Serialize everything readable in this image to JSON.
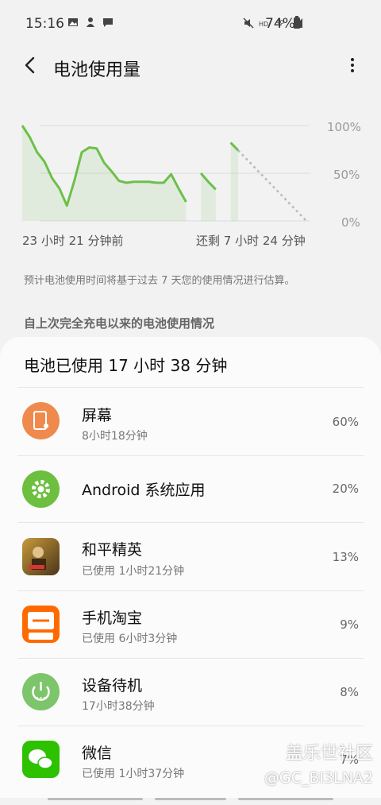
{
  "status": {
    "time": "15:16",
    "battery": "74%",
    "icons_left": [
      "image-icon",
      "person-icon",
      "message-icon"
    ],
    "icons_right": [
      "mute-icon",
      "hd-icon",
      "4g-icon",
      "signal-icon",
      "battery-icon"
    ]
  },
  "appbar": {
    "title": "电池使用量"
  },
  "chart": {
    "y_ticks": [
      "100%",
      "50%",
      "0%"
    ],
    "x_left": "23 小时 21 分钟前",
    "x_right": "还剩 7 小时 24 分钟",
    "line_color": "#6cc04a",
    "series": [
      100,
      88,
      72,
      62,
      45,
      34,
      16,
      42,
      72,
      77,
      76,
      61,
      52,
      42,
      40,
      41,
      41,
      41,
      40,
      40,
      49,
      34,
      20,
      null,
      50,
      41,
      33,
      null,
      82,
      74
    ]
  },
  "hint": "预计电池使用时间将基于过去 7 天您的使用情况进行估算。",
  "section_title": "自上次完全充电以来的电池使用情况",
  "card": {
    "title": "电池已使用 17 小时 38 分钟",
    "apps": [
      {
        "name": "屏幕",
        "sub": "8小时18分钟",
        "pct": "60%",
        "icon": "screen-icon",
        "color": "#ef8a4e"
      },
      {
        "name": "Android 系统应用",
        "sub": "",
        "pct": "20%",
        "icon": "gear-icon",
        "color": "#6dbf3f"
      },
      {
        "name": "和平精英",
        "sub": "已使用 1小时21分钟",
        "pct": "13%",
        "icon": "game-icon",
        "color": "#7a5a2a"
      },
      {
        "name": "手机淘宝",
        "sub": "已使用 6小时3分钟",
        "pct": "9%",
        "icon": "taobao-icon",
        "color": "#ff6a00"
      },
      {
        "name": "设备待机",
        "sub": "17小时38分钟",
        "pct": "8%",
        "icon": "power-icon",
        "color": "#7cc56b"
      },
      {
        "name": "微信",
        "sub": "已使用 1小时37分钟",
        "pct": "7%",
        "icon": "wechat-icon",
        "color": "#2dc100"
      }
    ]
  },
  "watermark": {
    "line1": "盖乐世社区",
    "line2": "@GC_BI3LNA2"
  }
}
